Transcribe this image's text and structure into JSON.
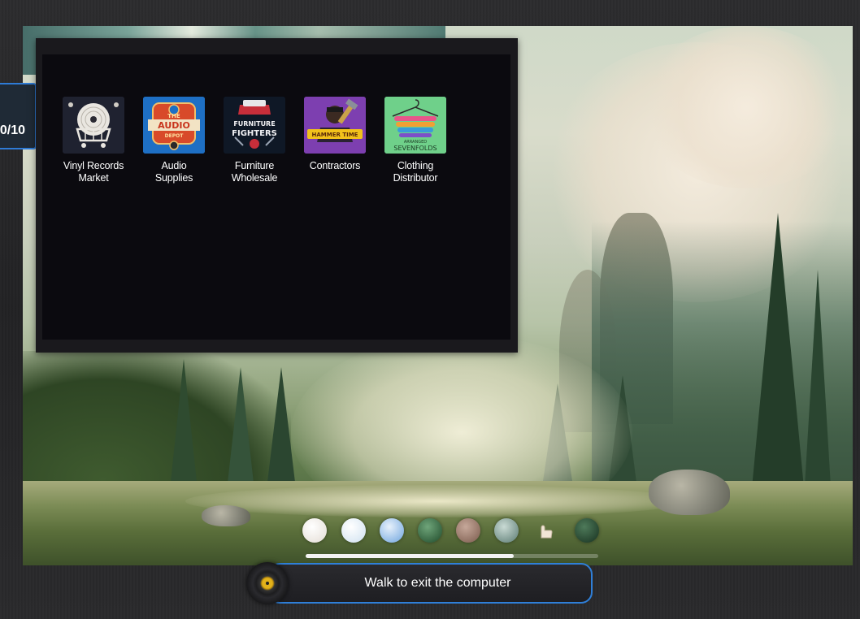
{
  "counter": {
    "text": "0/10"
  },
  "desktop_icons": [
    {
      "label_line1": "Vinyl Records",
      "label_line2": "Market",
      "icon": "vinyl-cart-icon",
      "tile_color": "#1f2230"
    },
    {
      "label_line1": "Audio",
      "label_line2": "Supplies",
      "icon": "audio-depot-logo-icon",
      "tile_color": "#1e6fc4"
    },
    {
      "label_line1": "Furniture",
      "label_line2": "Wholesale",
      "icon": "furniture-fighters-logo-icon",
      "tile_color": "#0f1826"
    },
    {
      "label_line1": "Contractors",
      "label_line2": "",
      "icon": "hammer-time-logo-icon",
      "tile_color": "#7d3fb0"
    },
    {
      "label_line1": "Clothing",
      "label_line2": "Distributor",
      "icon": "sevenfolds-hanger-logo-icon",
      "tile_color": "#6fd08a"
    }
  ],
  "logo_text": {
    "audio_top": "THE",
    "audio_main": "AUDIO",
    "audio_sub": "DEPOT",
    "furniture_main": "FURNITURE",
    "furniture_sub": "FIGHTERS",
    "contractors_main": "HAMMER TIME",
    "clothing_top": "ARRANGED",
    "clothing_main": "SEVENFOLDS"
  },
  "dock": {
    "items": [
      {
        "icon": "white-orb-icon",
        "color": "#f1ede8"
      },
      {
        "icon": "glass-orb-icon",
        "color": "#eef4fa"
      },
      {
        "icon": "blue-cup-icon",
        "color": "#7fb0e6"
      },
      {
        "icon": "green-leaf-icon",
        "color": "#2e6a3e"
      },
      {
        "icon": "brown-orb-icon",
        "color": "#9a7a6a"
      },
      {
        "icon": "teal-orb-icon",
        "color": "#7a9a92"
      },
      {
        "icon": "hand-cursor-icon",
        "color": "#f2e6d6"
      },
      {
        "icon": "dark-green-orb-icon",
        "color": "#2b4b35"
      }
    ],
    "progress": 0.71
  },
  "prompt": {
    "text": "Walk to exit the computer"
  },
  "colors": {
    "accent": "#2f7fd8",
    "window_bg": "#0b0a0f"
  }
}
